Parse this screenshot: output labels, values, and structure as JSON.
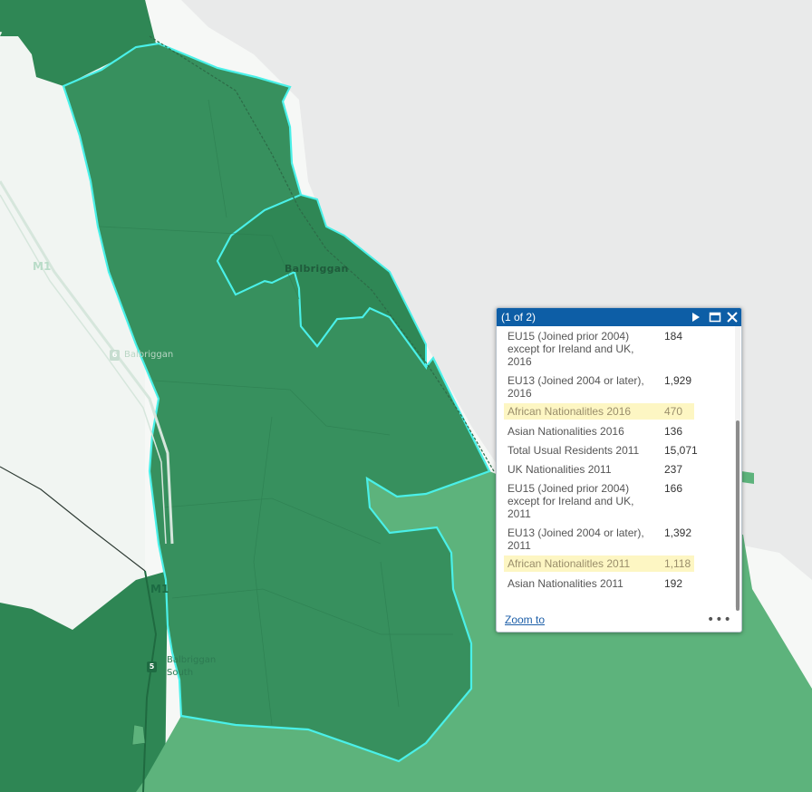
{
  "map": {
    "town_label": "Balbriggan",
    "motorway_label": "M1",
    "junction_north": {
      "number": "6",
      "name": "Balbriggan"
    },
    "junction_south": {
      "number": "5",
      "name_line1": "Balbriggan",
      "name_line2": "South"
    }
  },
  "popup": {
    "title": "(1 of 2)",
    "rows": [
      {
        "field_lines": [
          "EU15 (Joined prior 2004)",
          "except for Ireland and UK,",
          "2016"
        ],
        "value": "184",
        "highlight": false
      },
      {
        "field_lines": [
          "EU13 (Joined 2004 or later),",
          "2016"
        ],
        "value": "1,929",
        "highlight": false
      },
      {
        "field_lines": [
          "African Nationalitles 2016"
        ],
        "value": "470",
        "highlight": true
      },
      {
        "field_lines": [
          "Asian Nationalities 2016"
        ],
        "value": "136",
        "highlight": false
      },
      {
        "field_lines": [
          "Total Usual Residents 2011"
        ],
        "value": "15,071",
        "highlight": false
      },
      {
        "field_lines": [
          "UK Nationalities 2011"
        ],
        "value": "237",
        "highlight": false
      },
      {
        "field_lines": [
          "EU15 (Joined prior 2004)",
          "except for Ireland and UK,",
          "2011"
        ],
        "value": "166",
        "highlight": false
      },
      {
        "field_lines": [
          "EU13 (Joined 2004 or later),",
          "2011"
        ],
        "value": "1,392",
        "highlight": false
      },
      {
        "field_lines": [
          "African Nationalitles 2011"
        ],
        "value": "1,118",
        "highlight": true
      },
      {
        "field_lines": [
          "Asian Nationalities 2011"
        ],
        "value": "192",
        "highlight": false
      }
    ],
    "zoom_label": "Zoom to",
    "more_label": "•••"
  },
  "colors": {
    "sea": "#e9eaea",
    "land_light": "#f1f5f2",
    "selected_fill": "#38915f",
    "dark_fill": "#2e8654",
    "medium_fill": "#5cb47c",
    "outline": "#4af0e8",
    "popup_header": "#0d5ea6",
    "highlight": "#fdf6c3"
  }
}
